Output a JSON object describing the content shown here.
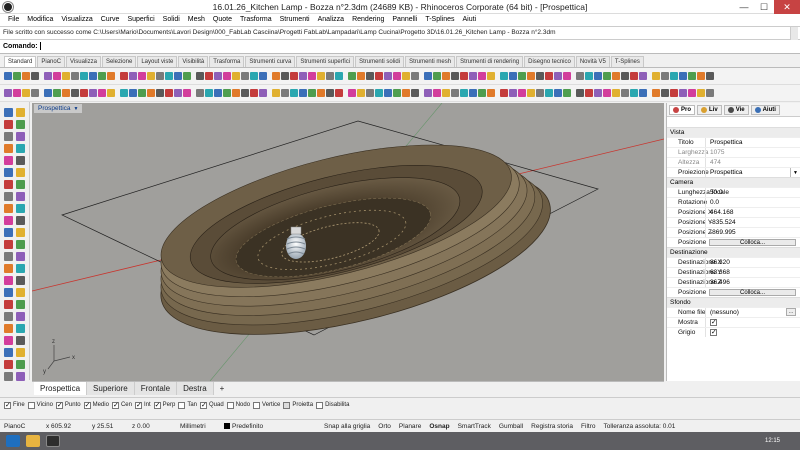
{
  "window": {
    "title": "16.01.26_Kitchen Lamp - Bozza n°2.3dm (24689 KB) - Rhinoceros Corporate (64 bit) - [Prospettica]",
    "minimize": "—",
    "maximize": "☐",
    "close": "✕"
  },
  "menu": [
    "File",
    "Modifica",
    "Visualizza",
    "Curve",
    "Superfici",
    "Solidi",
    "Mesh",
    "Quote",
    "Trasforma",
    "Strumenti",
    "Analizza",
    "Rendering",
    "Pannelli",
    "T-Splines",
    "Aiuti"
  ],
  "history": "File scritto con successo come C:\\Users\\Mario\\Documents\\Lavori Design\\000_FabLab Casciina\\Progetti FabLab\\Lampadari\\Lamp Cucina\\Progetto 3D\\16.01.26_Kitchen Lamp - Bozza n°2.3dm",
  "command": {
    "label": "Comando:",
    "value": ""
  },
  "toolbar_tabs": [
    "Standard",
    "PianoC",
    "Visualizza",
    "Selezione",
    "Layout viste",
    "Visibilità",
    "Trasforma",
    "Strumenti curva",
    "Strumenti superfici",
    "Strumenti solidi",
    "Strumenti mesh",
    "Strumenti di rendering",
    "Disegno tecnico",
    "Novità V5",
    "T-Splines"
  ],
  "viewport": {
    "name": "Prospettica",
    "tabs": [
      "Prospettica",
      "Superiore",
      "Frontale",
      "Destra"
    ],
    "add_tab": "+",
    "axis_labels": {
      "x": "x",
      "y": "y",
      "z": "z"
    }
  },
  "osnap": [
    {
      "label": "Fine",
      "on": true
    },
    {
      "label": "Vicino",
      "on": false
    },
    {
      "label": "Punto",
      "on": true
    },
    {
      "label": "Medio",
      "on": true
    },
    {
      "label": "Cen",
      "on": true
    },
    {
      "label": "Int",
      "on": true
    },
    {
      "label": "Perp",
      "on": true
    },
    {
      "label": "Tan",
      "on": false
    },
    {
      "label": "Quad",
      "on": true
    },
    {
      "label": "Nodo",
      "on": false
    },
    {
      "label": "Vertice",
      "on": false
    },
    {
      "label": "Proietta",
      "on": false,
      "disabled": true
    },
    {
      "label": "Disabilita",
      "on": false
    }
  ],
  "status": {
    "cplane": "PianoC",
    "x": "x 605.92",
    "y": "y 25.51",
    "z": "z 0.00",
    "units": "Millimetri",
    "layer": "Predefinito",
    "toggles": [
      "Snap alla griglia",
      "Orto",
      "Planare",
      "Osnap",
      "SmartTrack",
      "Gumball",
      "Registra storia",
      "Filtro"
    ],
    "tolerance": "Tolleranza assoluta: 0.01",
    "clock": "12:15"
  },
  "panel": {
    "tabs": [
      "Pro",
      "Liv",
      "Vie",
      "Aiuti"
    ],
    "sections": {
      "vista": "Vista",
      "camera": "Camera",
      "destinazione": "Destinazione",
      "sfondo": "Sfondo"
    },
    "vista": [
      {
        "k": "Titolo",
        "v": "Prospettica"
      },
      {
        "k": "Larghezza",
        "v": "1075",
        "grey": true
      },
      {
        "k": "Altezza",
        "v": "474",
        "grey": true
      },
      {
        "k": "Proiezione",
        "v": "Prospettica"
      }
    ],
    "camera": [
      {
        "k": "Lunghezza focale",
        "v": "50.0"
      },
      {
        "k": "Rotazione",
        "v": "0.0"
      },
      {
        "k": "Posizione X",
        "v": "464.168"
      },
      {
        "k": "Posizione Y",
        "v": "-835.524"
      },
      {
        "k": "Posizione Z",
        "v": "-869.995"
      },
      {
        "k": "Posizione",
        "v": "Colloca..."
      }
    ],
    "destinazione": [
      {
        "k": "Destinazione X",
        "v": "86.320"
      },
      {
        "k": "Destinazione Y",
        "v": "63.368"
      },
      {
        "k": "Destinazione Z",
        "v": "36.496"
      },
      {
        "k": "Posizione",
        "v": "Colloca..."
      }
    ],
    "sfondo": [
      {
        "k": "Nome file",
        "v": "(nessuno)"
      },
      {
        "k": "Mostra",
        "on": true
      },
      {
        "k": "Grigio",
        "on": true
      }
    ]
  },
  "colors": {
    "accent": "#c74343",
    "viewport_bg": "#a09f9c",
    "lamp": "#5a4c38"
  }
}
